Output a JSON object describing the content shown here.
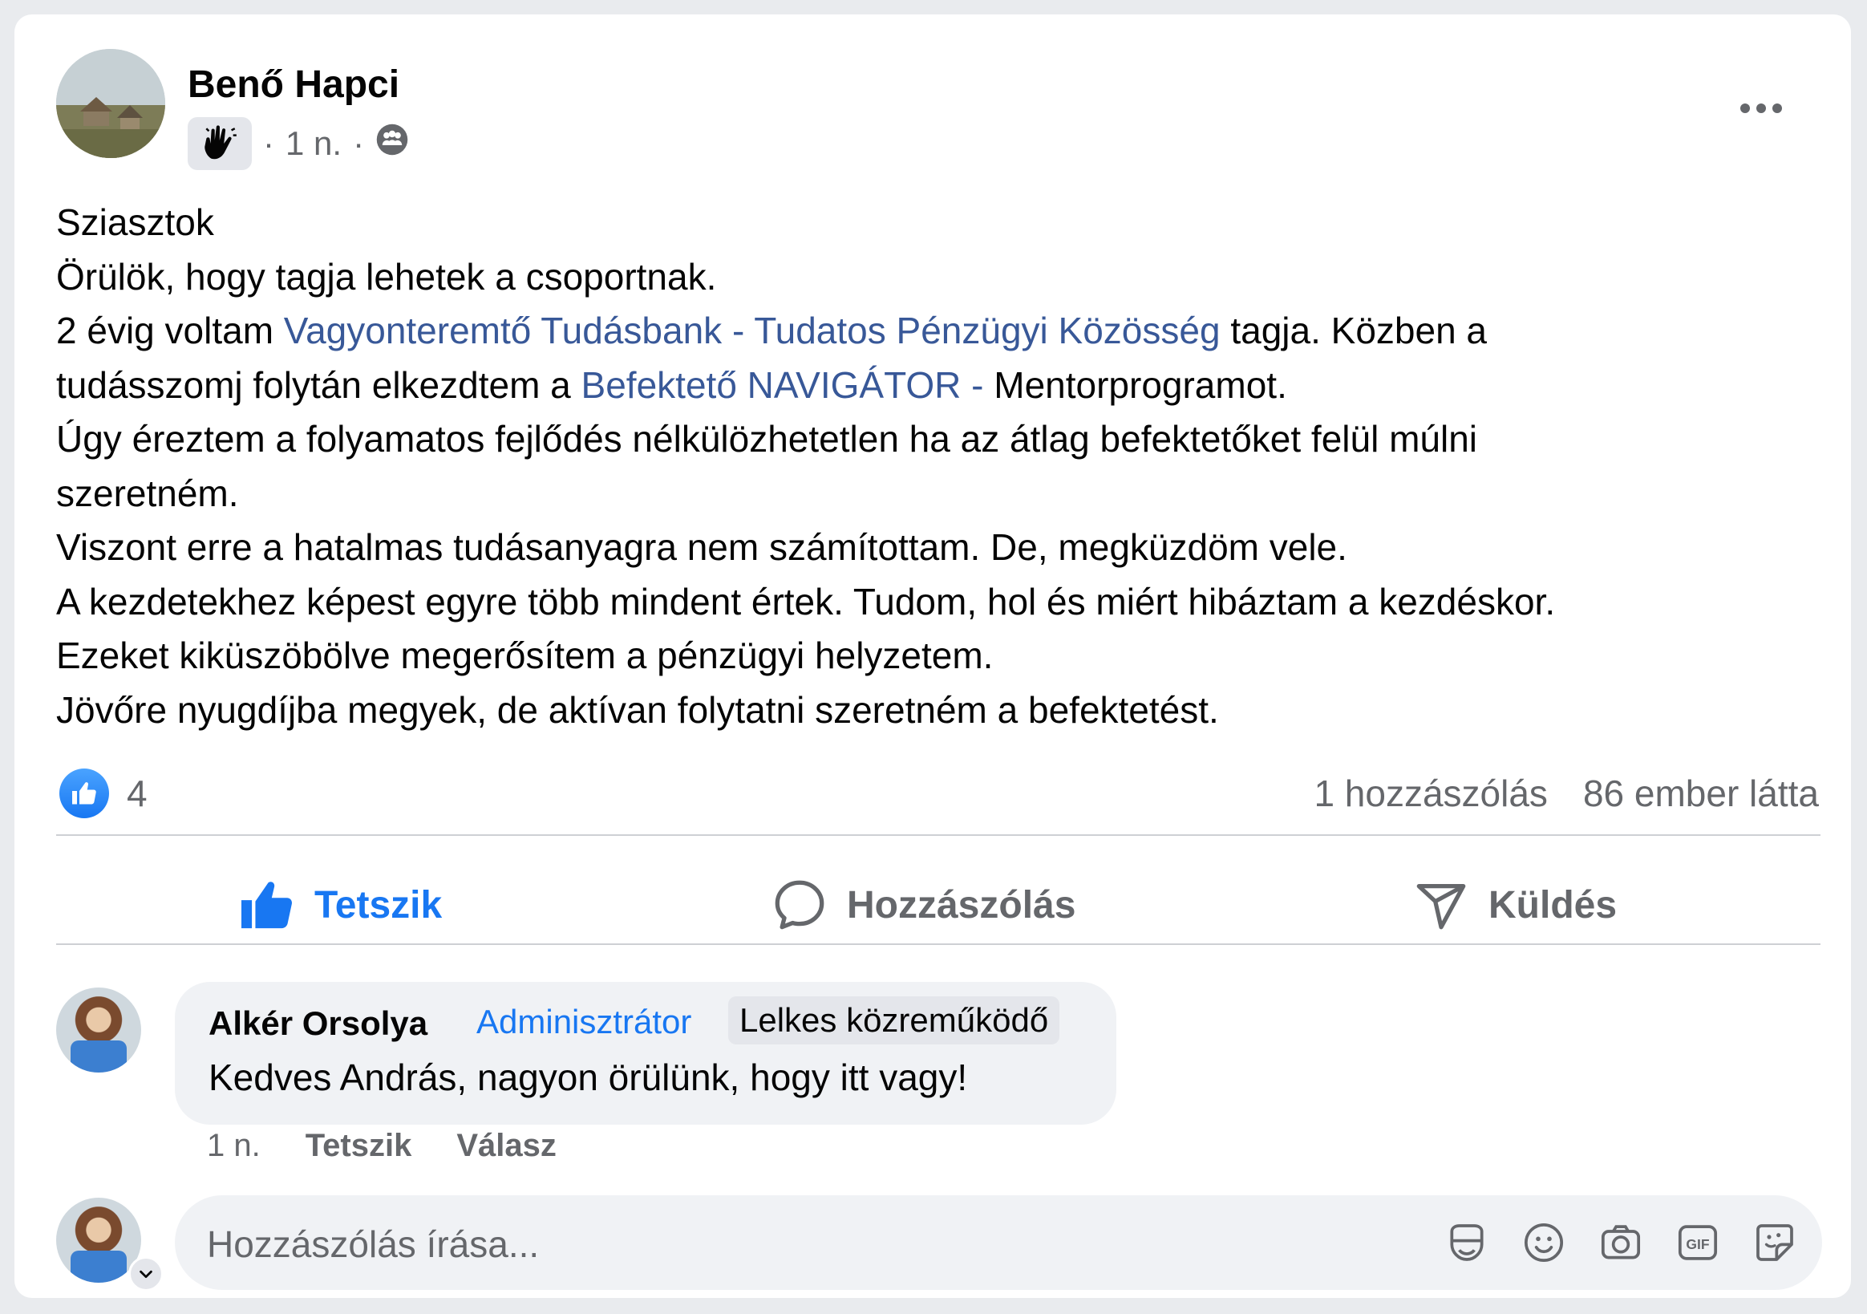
{
  "post": {
    "author": "Benő Hapci",
    "time": "1 n.",
    "separator": "·",
    "body": {
      "line1": "Sziasztok",
      "line2": "Örülök, hogy tagja lehetek a csoportnak.",
      "line3_a": "2 évig voltam ",
      "line3_link": "Vagyonteremtő Tudásbank - Tudatos Pénzügyi Közösség",
      "line3_b": " tagja. Közben a",
      "line4_a": "tudásszomj folytán elkezdtem a ",
      "line4_link": "Befektető NAVIGÁTOR -",
      "line4_b": " Mentorprogramot.",
      "line5": "Úgy éreztem a folyamatos fejlődés nélkülözhetetlen ha az átlag befektetőket felül múlni",
      "line6": "szeretném.",
      "line7": "Viszont erre a hatalmas tudásanyagra nem számítottam. De, megküzdöm vele.",
      "line8": "A kezdetekhez képest egyre több mindent értek. Tudom, hol és miért hibáztam a kezdéskor.",
      "line9": "Ezeket kiküszöbölve megerősítem a pénzügyi helyzetem.",
      "line10": "Jövőre nyugdíjba megyek, de aktívan folytatni szeretném a befektetést."
    },
    "reactions_count": "4",
    "comments_count": "1 hozzászólás",
    "views": "86 ember látta"
  },
  "actions": {
    "like": "Tetszik",
    "comment": "Hozzászólás",
    "send": "Küldés"
  },
  "comment": {
    "author": "Alkér Orsolya",
    "role": "Adminisztrátor",
    "badge": "Lelkes közreműködő",
    "text": "Kedves András, nagyon örülünk, hogy itt vagy!",
    "time": "1 n.",
    "like": "Tetszik",
    "reply": "Válasz"
  },
  "composer": {
    "placeholder": "Hozzászólás írása..."
  },
  "icons": [
    "wave-badge-icon",
    "group-audience-icon",
    "more-icon",
    "like-reaction-icon",
    "thumbs-up-icon",
    "comment-bubble-icon",
    "send-icon",
    "avatar-sticker-icon",
    "emoji-icon",
    "camera-icon",
    "gif-icon",
    "sticker-icon",
    "chevron-down-icon"
  ],
  "colors": {
    "accent": "#1877f2",
    "link": "#385898",
    "muted": "#65676b",
    "bubble": "#f0f2f5"
  }
}
